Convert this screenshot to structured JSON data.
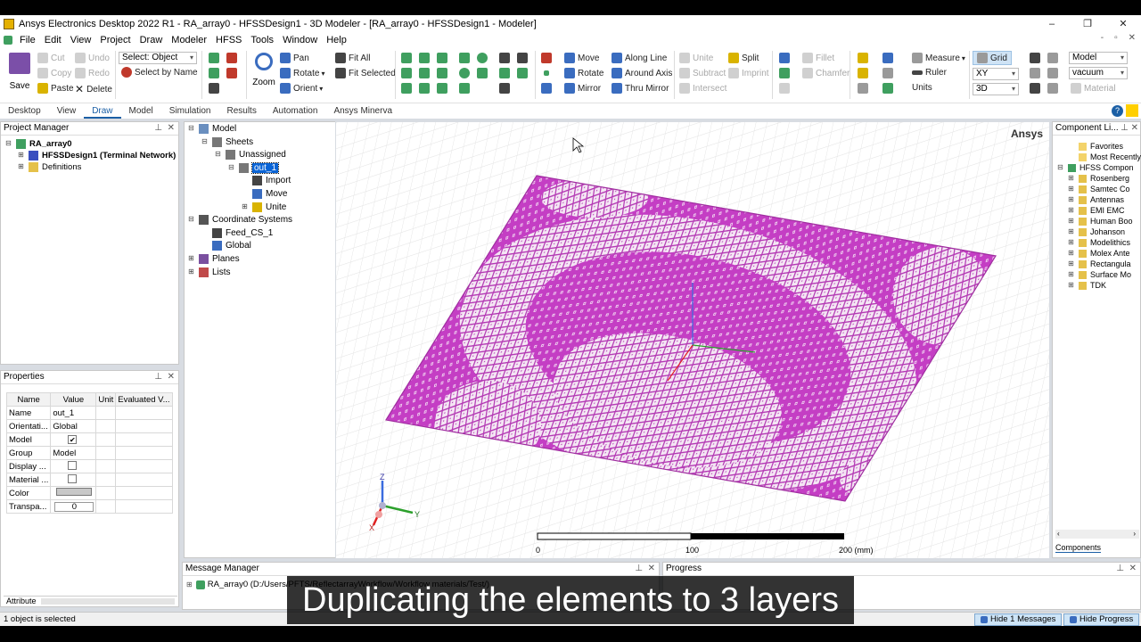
{
  "window": {
    "title": "Ansys Electronics Desktop 2022 R1 - RA_array0 - HFSSDesign1 - 3D Modeler - [RA_array0 - HFSSDesign1 - Modeler]",
    "min": "–",
    "max": "❐",
    "close": "✕",
    "mdi_min": "-",
    "mdi_max": "▫",
    "mdi_close": "✕"
  },
  "menu": [
    "File",
    "Edit",
    "View",
    "Project",
    "Draw",
    "Modeler",
    "HFSS",
    "Tools",
    "Window",
    "Help"
  ],
  "ribbon": {
    "save": "Save",
    "cut": "Cut",
    "copy": "Copy",
    "paste": "Paste",
    "undo": "Undo",
    "redo": "Redo",
    "delete": "Delete",
    "select_value": "Select: Object",
    "select_by_name": "Select by Name",
    "zoom": "Zoom",
    "pan": "Pan",
    "rotate": "Rotate",
    "orient": "Orient",
    "fit_all": "Fit All",
    "fit_selected": "Fit Selected",
    "move": "Move",
    "rotate2": "Rotate",
    "mirror": "Mirror",
    "along_line": "Along Line",
    "around_axis": "Around Axis",
    "thru_mirror": "Thru Mirror",
    "unite": "Unite",
    "subtract": "Subtract",
    "intersect": "Intersect",
    "split": "Split",
    "imprint": "Imprint",
    "fillet": "Fillet",
    "chamfer": "Chamfer",
    "measure": "Measure",
    "ruler": "Ruler",
    "units": "Units",
    "grid": "Grid",
    "plane_value": "XY",
    "dim_value": "3D",
    "model_value": "Model",
    "material_value": "vacuum",
    "material": "Material"
  },
  "tabs": [
    "Desktop",
    "View",
    "Draw",
    "Model",
    "Simulation",
    "Results",
    "Automation",
    "Ansys Minerva"
  ],
  "active_tab": "Draw",
  "project_manager": {
    "title": "Project Manager",
    "items": [
      {
        "label": "RA_array0",
        "indent": 0,
        "exp": "⊟",
        "bold": true
      },
      {
        "label": "HFSSDesign1 (Terminal Network)",
        "indent": 1,
        "exp": "⊞",
        "bold": true
      },
      {
        "label": "Definitions",
        "indent": 1,
        "exp": "⊞",
        "bold": false
      }
    ]
  },
  "model_tree": {
    "items": [
      {
        "label": "Model",
        "level": 0,
        "exp": "⊟"
      },
      {
        "label": "Sheets",
        "level": 1,
        "exp": "⊟"
      },
      {
        "label": "Unassigned",
        "level": 2,
        "exp": "⊟"
      },
      {
        "label": "out_1",
        "level": 3,
        "exp": "⊟",
        "selected": true
      },
      {
        "label": "Import",
        "level": 4,
        "exp": ""
      },
      {
        "label": "Move",
        "level": 4,
        "exp": ""
      },
      {
        "label": "Unite",
        "level": 4,
        "exp": "⊞"
      },
      {
        "label": "Coordinate Systems",
        "level": 0,
        "exp": "⊟"
      },
      {
        "label": "Feed_CS_1",
        "level": 1,
        "exp": ""
      },
      {
        "label": "Global",
        "level": 1,
        "exp": ""
      },
      {
        "label": "Planes",
        "level": 0,
        "exp": "⊞"
      },
      {
        "label": "Lists",
        "level": 0,
        "exp": "⊞"
      }
    ]
  },
  "properties": {
    "title": "Properties",
    "headers": [
      "Name",
      "Value",
      "Unit",
      "Evaluated V..."
    ],
    "rows": [
      {
        "name": "Name",
        "value": "out_1"
      },
      {
        "name": "Orientati...",
        "value": "Global"
      },
      {
        "name": "Model",
        "value": "✔"
      },
      {
        "name": "Group",
        "value": "Model"
      },
      {
        "name": "Display ...",
        "value": ""
      },
      {
        "name": "Material ...",
        "value": ""
      },
      {
        "name": "Color",
        "value": ""
      },
      {
        "name": "Transpa...",
        "value": "0"
      }
    ],
    "attribute_tab": "Attribute"
  },
  "viewport": {
    "brand": "Ansys",
    "scale_labels": [
      "0",
      "100",
      "200 (mm)"
    ],
    "axis_labels": {
      "z": "Z",
      "y": "Y",
      "x": "X"
    }
  },
  "component_library": {
    "title": "Component Li...",
    "items": [
      {
        "label": "Favorites",
        "indent": 1
      },
      {
        "label": "Most Recently",
        "indent": 1
      },
      {
        "label": "HFSS Compon",
        "indent": 0
      },
      {
        "label": "Rosenberg",
        "indent": 1
      },
      {
        "label": "Samtec Co",
        "indent": 1
      },
      {
        "label": "Antennas",
        "indent": 1
      },
      {
        "label": "EMI EMC",
        "indent": 1
      },
      {
        "label": "Human Boo",
        "indent": 1
      },
      {
        "label": "Johanson",
        "indent": 1
      },
      {
        "label": "Modelithics",
        "indent": 1
      },
      {
        "label": "Molex Ante",
        "indent": 1
      },
      {
        "label": "Rectangula",
        "indent": 1
      },
      {
        "label": "Surface Mo",
        "indent": 1
      },
      {
        "label": "TDK",
        "indent": 1
      }
    ],
    "tab": "Components"
  },
  "message_manager": {
    "title": "Message Manager",
    "entry": "RA_array0 (D:/Users/PFTS/ReflectarrayWorkflow/Workflow materials/Test/)"
  },
  "progress": {
    "title": "Progress"
  },
  "status": {
    "text": "1 object is selected",
    "hide_messages": "Hide 1 Messages",
    "hide_progress": "Hide Progress"
  },
  "subtitle": "Duplicating the elements to 3 layers",
  "colors": {
    "array": "#c23ec2",
    "accent": "#1b5fa5",
    "selection": "#0a64d6"
  }
}
